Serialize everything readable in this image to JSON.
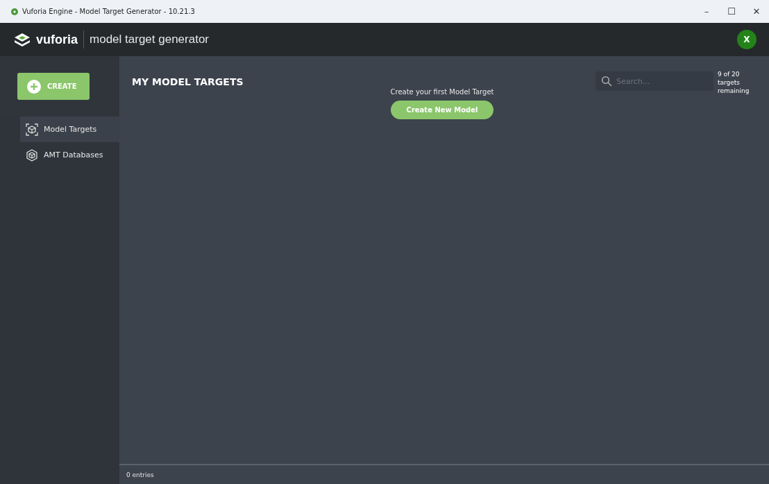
{
  "window": {
    "title": "Vuforia Engine - Model Target Generator - 10.21.3",
    "controls": [
      "–",
      "☐",
      "✕"
    ]
  },
  "header": {
    "brand": "vuforia",
    "product": "model target generator",
    "avatar": "X"
  },
  "sidebar": {
    "create_button": "CREATE",
    "items": [
      {
        "label": "Model Targets",
        "selected": true,
        "kind": "targets"
      },
      {
        "label": "AMT Databases",
        "selected": false,
        "kind": "databases"
      }
    ]
  },
  "main": {
    "title": "MY MODEL TARGETS",
    "search": {
      "placeholder": "Search..."
    },
    "quota": [
      "9 of 20",
      "targets",
      "remaining"
    ],
    "empty_message": "Create your first Model Target",
    "create_new_button": "Create New Model"
  },
  "status_bar": {
    "entries": "0 entries"
  }
}
